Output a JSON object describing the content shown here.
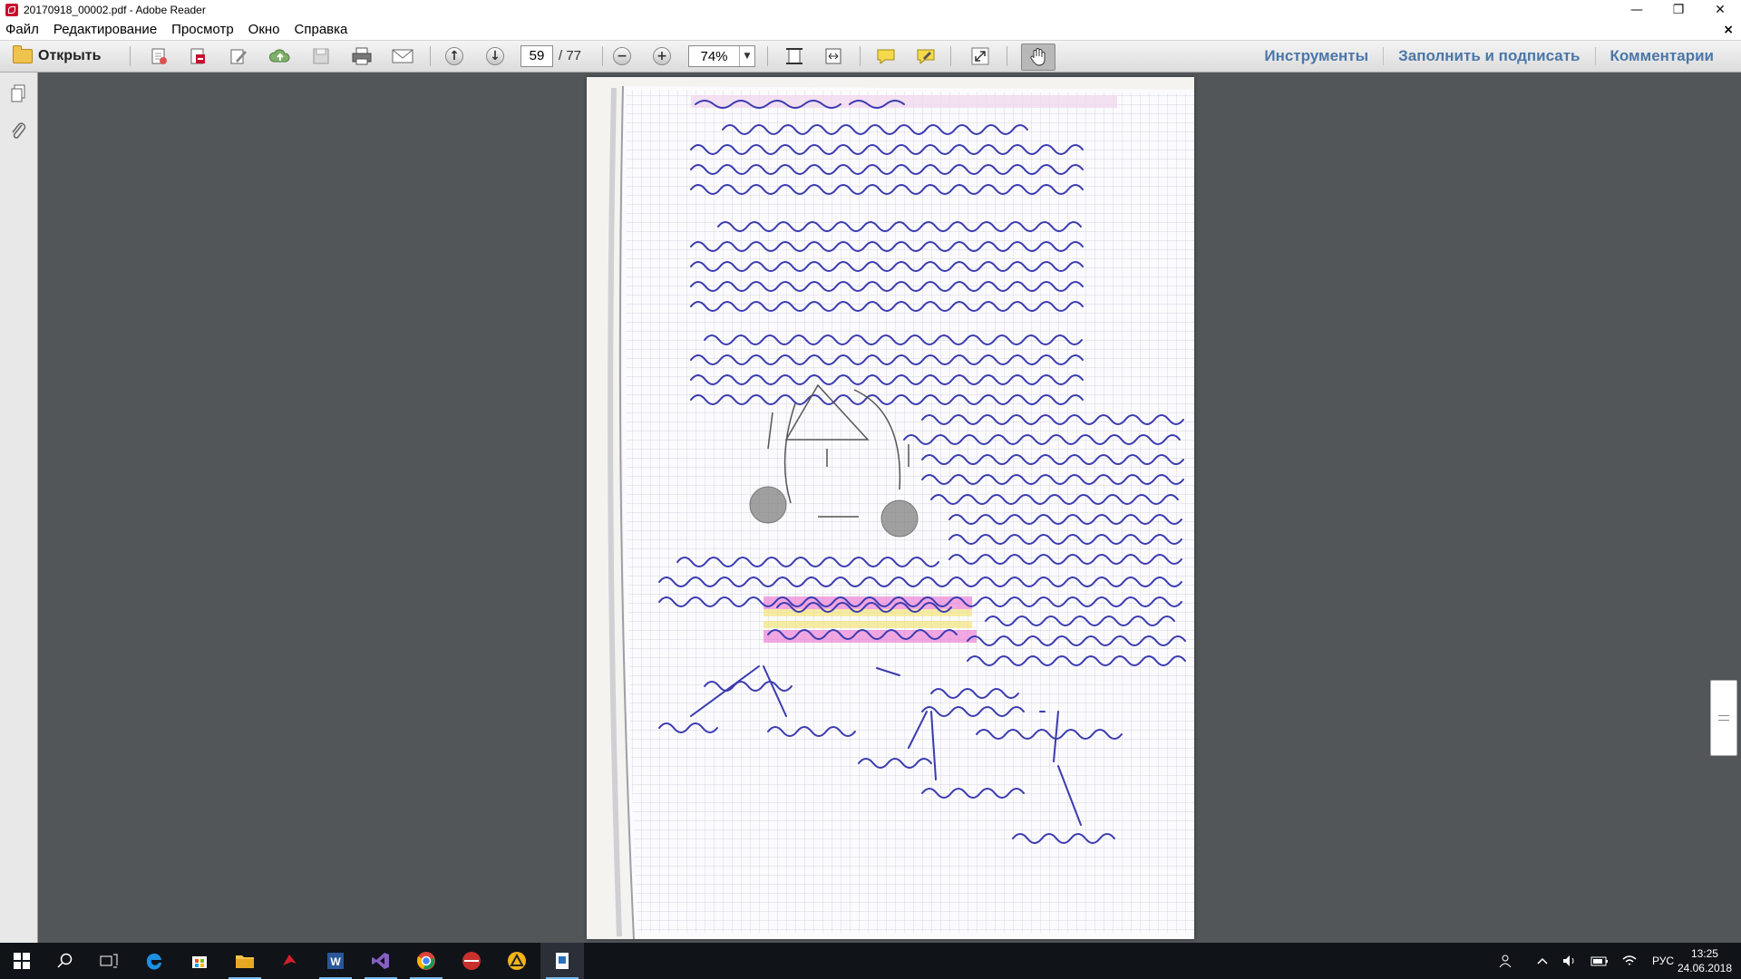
{
  "window": {
    "title": "20170918_00002.pdf - Adobe Reader",
    "minimize_label": "—",
    "restore_label": "❐",
    "close_label": "✕"
  },
  "menu": {
    "items": [
      "Файл",
      "Редактирование",
      "Просмотр",
      "Окно",
      "Справка"
    ],
    "close_doc_label": "×"
  },
  "toolbar": {
    "open_label": "Открыть",
    "page_current": "59",
    "page_total": "/ 77",
    "zoom": "74%",
    "right_links": [
      "Инструменты",
      "Заполнить и подписать",
      "Комментарии"
    ],
    "icons": [
      "create-pdf-icon",
      "export-pdf-icon",
      "edit-icon",
      "upload-cloud-icon",
      "save-icon",
      "print-icon",
      "email-icon",
      "prev-page-icon",
      "next-page-icon",
      "zoom-out-icon",
      "zoom-in-icon",
      "fit-page-icon",
      "fit-width-icon",
      "comment-icon",
      "highlight-icon",
      "fullscreen-icon",
      "hand-tool-icon"
    ]
  },
  "taskbar": {
    "apps": [
      "start-icon",
      "search-icon",
      "task-view-icon",
      "edge-icon",
      "store-icon",
      "file-explorer-icon",
      "app-red-icon",
      "word-icon",
      "visual-studio-icon",
      "chrome-icon",
      "app-circle-icon",
      "app-triangle-icon",
      "adobe-reader-icon"
    ],
    "tray_lang": "РУС",
    "clock_time": "13:25",
    "clock_date": "24.06.2018"
  },
  "colors": {
    "doc_background": "#525659",
    "link_blue": "#4b77a8",
    "taskbar": "#101318"
  }
}
